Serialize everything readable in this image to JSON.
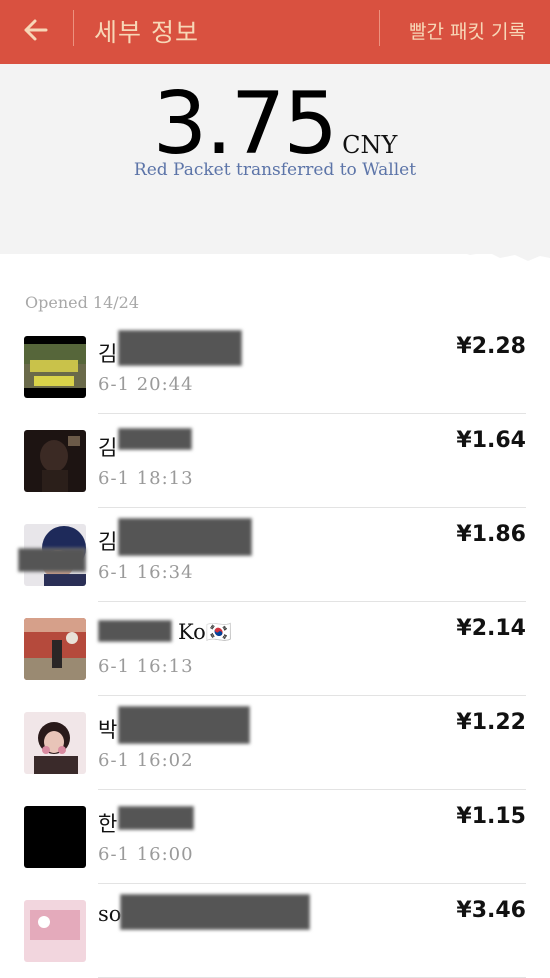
{
  "header": {
    "title": "세부 정보",
    "records_label": "빨간 패킷 기록"
  },
  "summary": {
    "amount": "3.75",
    "currency": "CNY",
    "subtitle": "Red Packet transferred to Wallet"
  },
  "opened_label": "Opened 14/24",
  "entries": [
    {
      "name_visible": "김",
      "time": "6-1  20:44",
      "amount": "¥2.28"
    },
    {
      "name_visible": "김",
      "time": "6-1  18:13",
      "amount": "¥1.64"
    },
    {
      "name_visible": "김",
      "time": "6-1  16:34",
      "amount": "¥1.86"
    },
    {
      "name_visible": "Ko🇰🇷",
      "time": "6-1  16:13",
      "amount": "¥2.14"
    },
    {
      "name_visible": "박",
      "time": "6-1  16:02",
      "amount": "¥1.22"
    },
    {
      "name_visible": "한",
      "time": "6-1  16:00",
      "amount": "¥1.15"
    },
    {
      "name_visible": "so",
      "time": "",
      "amount": "¥3.46"
    }
  ],
  "colors": {
    "header_bg": "#d95140",
    "header_text": "#f7d7b7",
    "subtitle": "#5c74a8",
    "summary_bg": "#f3f3f3"
  },
  "icons": {
    "back": "arrow-left-icon"
  }
}
